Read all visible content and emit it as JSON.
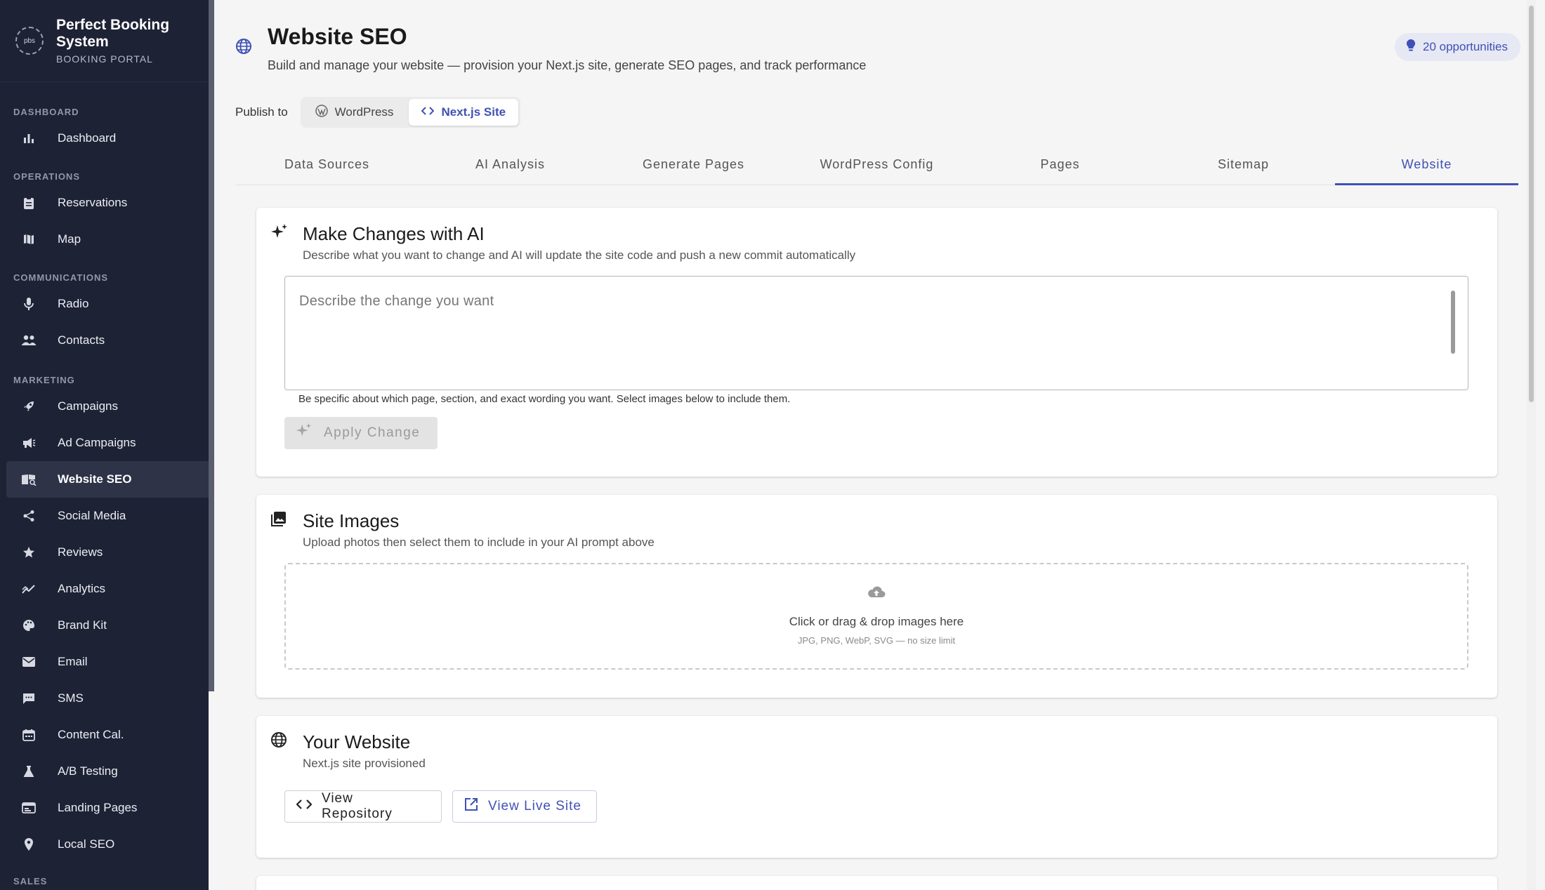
{
  "brand": {
    "name": "Perfect Booking System",
    "subtitle": "BOOKING PORTAL",
    "logo_text": "pbs"
  },
  "sidebar": {
    "sections": [
      {
        "label": "DASHBOARD",
        "items": [
          {
            "label": "Dashboard",
            "icon": "bar-chart-icon"
          }
        ]
      },
      {
        "label": "OPERATIONS",
        "items": [
          {
            "label": "Reservations",
            "icon": "clipboard-icon"
          },
          {
            "label": "Map",
            "icon": "map-icon"
          }
        ]
      },
      {
        "label": "COMMUNICATIONS",
        "items": [
          {
            "label": "Radio",
            "icon": "microphone-icon"
          },
          {
            "label": "Contacts",
            "icon": "people-icon"
          }
        ]
      },
      {
        "label": "MARKETING",
        "items": [
          {
            "label": "Campaigns",
            "icon": "rocket-icon"
          },
          {
            "label": "Ad Campaigns",
            "icon": "megaphone-icon"
          },
          {
            "label": "Website SEO",
            "icon": "book-search-icon",
            "active": true
          },
          {
            "label": "Social Media",
            "icon": "share-icon"
          },
          {
            "label": "Reviews",
            "icon": "star-icon"
          },
          {
            "label": "Analytics",
            "icon": "trend-icon"
          },
          {
            "label": "Brand Kit",
            "icon": "palette-icon"
          },
          {
            "label": "Email",
            "icon": "mail-icon"
          },
          {
            "label": "SMS",
            "icon": "chat-icon"
          },
          {
            "label": "Content Cal.",
            "icon": "calendar-icon"
          },
          {
            "label": "A/B Testing",
            "icon": "flask-icon"
          },
          {
            "label": "Landing Pages",
            "icon": "web-page-icon"
          },
          {
            "label": "Local SEO",
            "icon": "location-pin-icon"
          }
        ]
      },
      {
        "label": "SALES",
        "items": []
      }
    ]
  },
  "header": {
    "title": "Website SEO",
    "subtitle": "Build and manage your website — provision your Next.js site, generate SEO pages, and track performance",
    "opportunities": "20 opportunities"
  },
  "publish": {
    "label": "Publish to",
    "options": [
      {
        "label": "WordPress",
        "selected": false
      },
      {
        "label": "Next.js Site",
        "selected": true
      }
    ]
  },
  "tabs": [
    {
      "label": "Data Sources"
    },
    {
      "label": "AI Analysis"
    },
    {
      "label": "Generate Pages"
    },
    {
      "label": "WordPress Config"
    },
    {
      "label": "Pages"
    },
    {
      "label": "Sitemap"
    },
    {
      "label": "Website",
      "active": true
    }
  ],
  "ai_card": {
    "title": "Make Changes with AI",
    "description": "Describe what you want to change and AI will update the site code and push a new commit automatically",
    "placeholder": "Describe the change you want",
    "helper": "Be specific about which page, section, and exact wording you want. Select images below to include them.",
    "apply_label": "Apply Change"
  },
  "images_card": {
    "title": "Site Images",
    "description": "Upload photos then select them to include in your AI prompt above",
    "dropzone_main": "Click or drag & drop images here",
    "dropzone_sub": "JPG, PNG, WebP, SVG — no size limit"
  },
  "website_card": {
    "title": "Your Website",
    "description": "Next.js site provisioned",
    "repo_label": "View Repository",
    "live_label": "View Live Site"
  },
  "colors": {
    "sidebar_bg": "#1e2235",
    "accent": "#3f51b5",
    "page_bg": "#f5f5f5"
  }
}
